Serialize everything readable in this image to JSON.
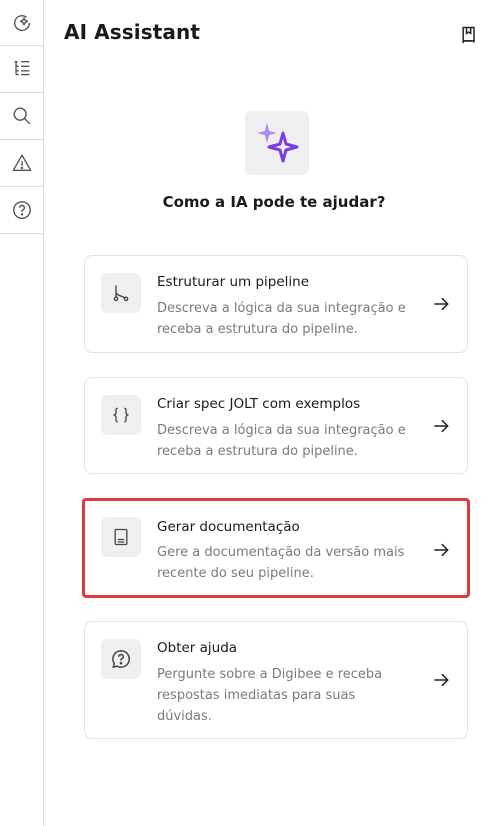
{
  "header": {
    "title": "AI Assistant"
  },
  "sidebar": {
    "items": [
      {
        "icon": "ai-refresh-icon"
      },
      {
        "icon": "tree-list-icon"
      },
      {
        "icon": "search-icon"
      },
      {
        "icon": "warning-icon"
      },
      {
        "icon": "help-icon"
      }
    ]
  },
  "intro": {
    "question": "Como a IA pode te ajudar?"
  },
  "cards": [
    {
      "title": "Estruturar um pipeline",
      "description": "Descreva a lógica da sua integração e receba a estrutura do pipeline.",
      "icon": "branch-icon"
    },
    {
      "title": "Criar spec JOLT com exemplos",
      "description": "Descreva a lógica da sua integração e receba a estrutura do pipeline.",
      "icon": "braces-icon"
    },
    {
      "title": "Gerar documentação",
      "description": "Gere a documentação da versão mais recente do seu pipeline.",
      "icon": "document-icon"
    },
    {
      "title": "Obter ajuda",
      "description": "Pergunte sobre a Digibee e receba respostas imediatas para suas dúvidas.",
      "icon": "help-bubble-icon"
    }
  ],
  "colors": {
    "accent": "#7c3aed",
    "accent_light": "#a78bfa",
    "highlight_border": "#e03a3e"
  }
}
